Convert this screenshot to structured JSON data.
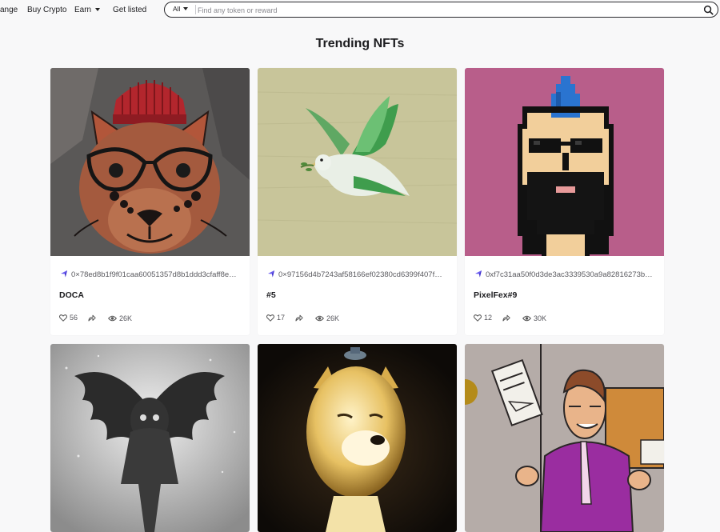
{
  "nav": {
    "items": [
      {
        "label": "ange",
        "dropdown": false
      },
      {
        "label": "Buy Crypto",
        "dropdown": false
      },
      {
        "label": "Earn",
        "dropdown": true
      },
      {
        "label": "Get listed",
        "dropdown": false
      }
    ]
  },
  "search": {
    "filter_label": "All",
    "placeholder": "Find any token or reward",
    "value": ""
  },
  "main": {
    "title": "Trending NFTs"
  },
  "nfts": [
    {
      "address": "0×78ed8b1f9f01caa60051357d8b1ddd3cfaff8e…",
      "name": "DOCA",
      "likes": "56",
      "views": "26K",
      "chain_icon": "ethereum-icon"
    },
    {
      "address": "0×97156d4b7243af58166ef02380cd6399f407f…",
      "name": "#5",
      "likes": "17",
      "views": "26K",
      "chain_icon": "ethereum-icon"
    },
    {
      "address": "0xf7c31aa50f0d3de3ac3339530a9a82816273b…",
      "name": "PixelFex#9",
      "likes": "12",
      "views": "30K",
      "chain_icon": "ethereum-icon"
    },
    {
      "address": "",
      "name": "",
      "likes": "",
      "views": ""
    },
    {
      "address": "",
      "name": "",
      "likes": "",
      "views": ""
    },
    {
      "address": "",
      "name": "",
      "likes": "",
      "views": ""
    }
  ],
  "colors": {
    "chain_icon": "#6a5cf0",
    "card_bg": "#ffffff",
    "page_bg": "#f8f8f9",
    "pixel_art_bg": "#b85e8a"
  }
}
